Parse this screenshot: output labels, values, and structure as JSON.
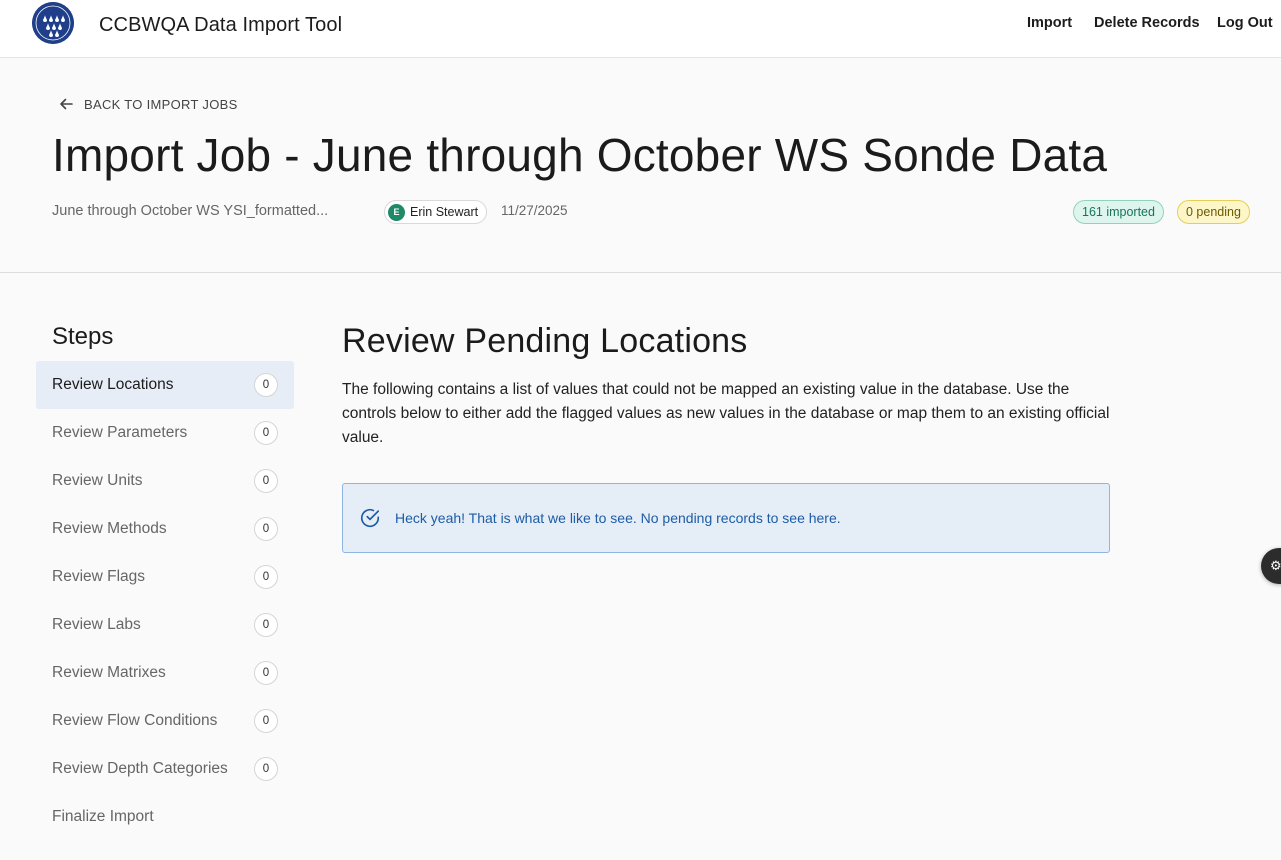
{
  "header": {
    "app_title": "CCBWQA Data Import Tool",
    "nav": [
      {
        "label": "Import"
      },
      {
        "label": "Delete Records"
      },
      {
        "label": "Log Out"
      }
    ]
  },
  "job": {
    "back_label": "BACK TO IMPORT JOBS",
    "title": "Import Job - June through October WS Sonde Data",
    "filename": "June through October WS YSI_formatted...",
    "user_initial": "E",
    "user_name": "Erin Stewart",
    "date": "11/27/2025",
    "imported_badge": "161 imported",
    "pending_badge": "0 pending"
  },
  "steps": {
    "title": "Steps",
    "items": [
      {
        "label": "Review Locations",
        "count": "0",
        "active": true
      },
      {
        "label": "Review Parameters",
        "count": "0"
      },
      {
        "label": "Review Units",
        "count": "0"
      },
      {
        "label": "Review Methods",
        "count": "0"
      },
      {
        "label": "Review Flags",
        "count": "0"
      },
      {
        "label": "Review Labs",
        "count": "0"
      },
      {
        "label": "Review Matrixes",
        "count": "0"
      },
      {
        "label": "Review Flow Conditions",
        "count": "0"
      },
      {
        "label": "Review Depth Categories",
        "count": "0"
      },
      {
        "label": "Finalize Import"
      }
    ]
  },
  "main": {
    "heading": "Review Pending Locations",
    "description": "The following contains a list of values that could not be mapped an existing value in the database. Use the controls below to either add the flagged values as new values in the database or map them to an existing official value.",
    "alert_text": "Heck yeah! That is what we like to see. No pending records to see here.",
    "alert_icon": "check-circle-icon"
  },
  "colors": {
    "accent_blue": "#1d5ca7",
    "imported_green": "#17745a",
    "pending_yellow": "#fdf6c9",
    "active_step_bg": "#e6edf6"
  }
}
